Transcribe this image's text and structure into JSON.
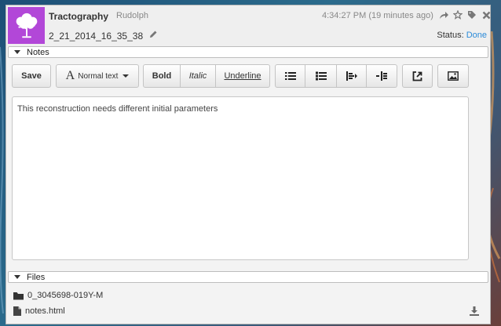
{
  "header": {
    "title": "Tractography",
    "owner": "Rudolph",
    "timestamp": "4:34:27 PM (19 minutes ago)",
    "session_name": "2_21_2014_16_35_38",
    "status_label": "Status:",
    "status_value": "Done",
    "avatar_color": "#b247d8",
    "icons": [
      "share-icon",
      "star-icon",
      "tag-icon",
      "close-icon"
    ]
  },
  "notes": {
    "section_label": "Notes",
    "toolbar": {
      "save": "Save",
      "text_style": "Normal text",
      "bold": "Bold",
      "italic": "Italic",
      "underline": "Underline",
      "icons": [
        "bullet-list-icon",
        "numbered-list-icon",
        "outdent-icon",
        "indent-icon",
        "link-icon",
        "image-icon"
      ]
    },
    "content": "This reconstruction needs different initial parameters"
  },
  "files": {
    "section_label": "Files",
    "items": [
      {
        "name": "0_3045698-019Y-M",
        "type": "folder"
      },
      {
        "name": "notes.html",
        "type": "file"
      }
    ]
  },
  "colors": {
    "link": "#2a8ad8",
    "avatar": "#b247d8"
  }
}
